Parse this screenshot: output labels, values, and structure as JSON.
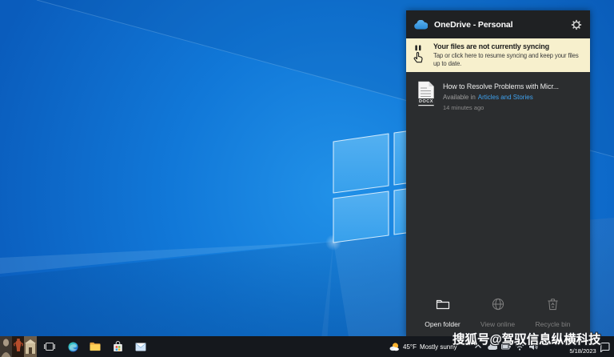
{
  "onedrive_panel": {
    "header": {
      "title": "OneDrive - Personal"
    },
    "banner": {
      "title": "Your files are not currently syncing",
      "description_line1": "Tap or click here to resume syncing and keep your files",
      "description_line2": "up to date."
    },
    "file_item": {
      "badge": "DOCX",
      "title": "How to Resolve Problems with Micr...",
      "location_prefix": "Available in",
      "location_link": "Articles and Stories",
      "time": "14 minutes ago"
    },
    "actions": [
      {
        "label": "Open folder"
      },
      {
        "label": "View online"
      },
      {
        "label": "Recycle bin"
      }
    ]
  },
  "taskbar": {
    "tray": {
      "temperature": "45°F",
      "condition": "Mostly sunny",
      "date": "5/18/2023"
    }
  },
  "watermark": {
    "text": "搜狐号@驾驭信息纵横科技"
  },
  "colors": {
    "desktop_blue": "#0f6fd0",
    "banner_bg": "#f7f0cd",
    "link_blue": "#3fa2ef"
  }
}
